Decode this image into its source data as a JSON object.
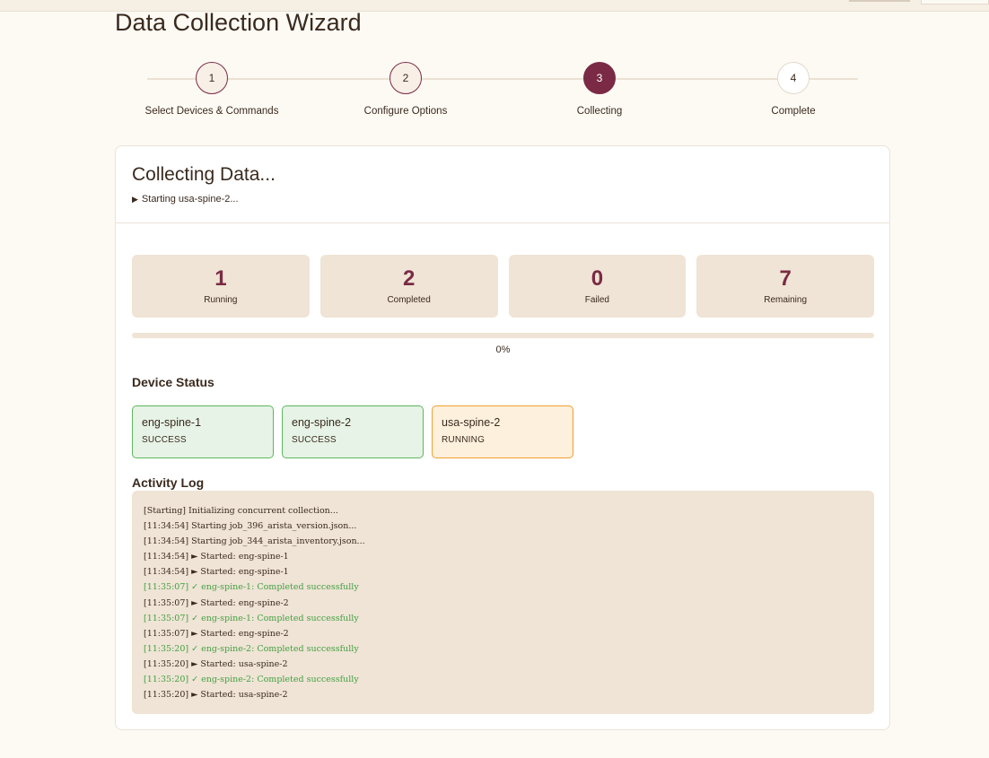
{
  "page": {
    "title": "Data Collection Wizard"
  },
  "stepper": {
    "steps": [
      {
        "number": "1",
        "label": "Select Devices & Commands",
        "state": "done"
      },
      {
        "number": "2",
        "label": "Configure Options",
        "state": "done"
      },
      {
        "number": "3",
        "label": "Collecting",
        "state": "active"
      },
      {
        "number": "4",
        "label": "Complete",
        "state": "todo"
      }
    ]
  },
  "card": {
    "title": "Collecting Data...",
    "subtitle_icon": "play-icon",
    "subtitle_glyph": "▶",
    "subtitle": "Starting usa-spine-2..."
  },
  "stats": [
    {
      "value": "1",
      "label": "Running"
    },
    {
      "value": "2",
      "label": "Completed"
    },
    {
      "value": "0",
      "label": "Failed"
    },
    {
      "value": "7",
      "label": "Remaining"
    }
  ],
  "progress": {
    "percent": 0,
    "text": "0%"
  },
  "device_status": {
    "title": "Device Status",
    "devices": [
      {
        "name": "eng-spine-1",
        "status": "SUCCESS",
        "state": "success"
      },
      {
        "name": "eng-spine-2",
        "status": "SUCCESS",
        "state": "success"
      },
      {
        "name": "usa-spine-2",
        "status": "RUNNING",
        "state": "running"
      }
    ]
  },
  "activity_log": {
    "title": "Activity Log",
    "lines": [
      {
        "text": "[Starting] Initializing concurrent collection...",
        "kind": "info"
      },
      {
        "text": "[11:34:54] Starting job_396_arista_version.json...",
        "kind": "info"
      },
      {
        "text": "[11:34:54] Starting job_344_arista_inventory.json...",
        "kind": "info"
      },
      {
        "text": "[11:34:54] ► Started: eng-spine-1",
        "kind": "info"
      },
      {
        "text": "[11:34:54] ► Started: eng-spine-1",
        "kind": "info"
      },
      {
        "text": "[11:35:07] ✓ eng-spine-1: Completed successfully",
        "kind": "ok"
      },
      {
        "text": "[11:35:07] ► Started: eng-spine-2",
        "kind": "info"
      },
      {
        "text": "[11:35:07] ✓ eng-spine-1: Completed successfully",
        "kind": "ok"
      },
      {
        "text": "[11:35:07] ► Started: eng-spine-2",
        "kind": "info"
      },
      {
        "text": "[11:35:20] ✓ eng-spine-2: Completed successfully",
        "kind": "ok"
      },
      {
        "text": "[11:35:20] ► Started: usa-spine-2",
        "kind": "info"
      },
      {
        "text": "[11:35:20] ✓ eng-spine-2: Completed successfully",
        "kind": "ok"
      },
      {
        "text": "[11:35:20] ► Started: usa-spine-2",
        "kind": "info"
      }
    ]
  },
  "colors": {
    "accent": "#7a2a45",
    "success_bg": "#e6f3e6",
    "success_border": "#5cb85c",
    "running_bg": "#fdf0dc",
    "running_border": "#f0a030",
    "panel_bg": "#efe4d5",
    "log_success": "#45a045"
  }
}
